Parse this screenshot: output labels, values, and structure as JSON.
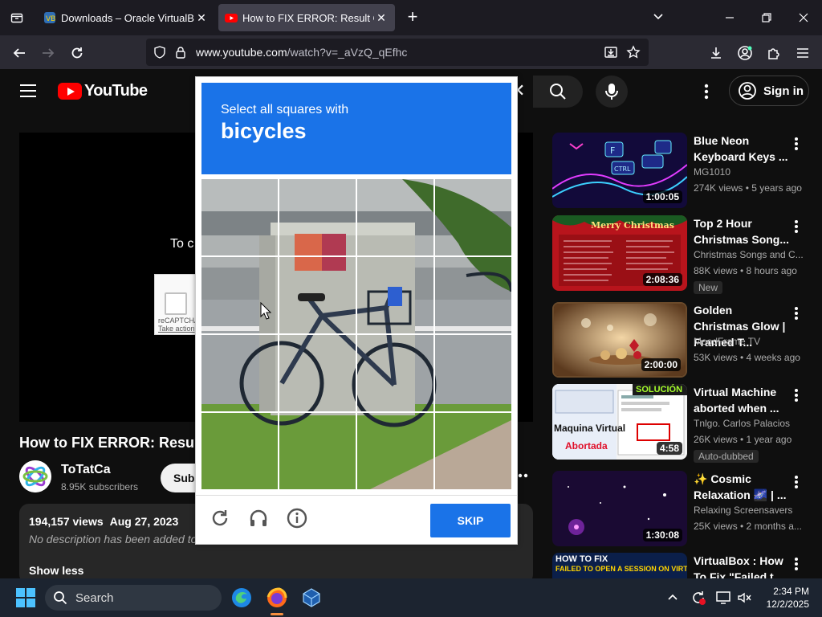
{
  "browser": {
    "tabs": [
      {
        "title": "Downloads – Oracle VirtualBox",
        "active": false
      },
      {
        "title": "How to FIX ERROR: Result Code",
        "active": true
      }
    ],
    "url_host": "www.youtube.com",
    "url_path": "/watch?v=_aVzQ_qEfhc"
  },
  "youtube": {
    "logo_text": "YouTube",
    "sign_in_label": "Sign in",
    "player_partial_text": "To c",
    "recaptcha_label": "reCAPTCHA",
    "recaptcha_action": "Take action",
    "video_title": "How to FIX ERROR: Resu",
    "channel_name": "ToTatCa",
    "channel_subs": "8.95K subscribers",
    "subscribe_label": "Subs",
    "views": "194,157 views",
    "date": "Aug 27, 2023",
    "description": "No description has been added to",
    "show_less": "Show less"
  },
  "recommendations": [
    {
      "title": "Blue Neon Keyboard Keys ...",
      "channel": "MG1010",
      "meta": "274K views • 5 years ago",
      "duration": "1:00:05",
      "badge": ""
    },
    {
      "title": "Top 2 Hour Christmas Song...",
      "channel": "Christmas Songs and C...",
      "meta": "88K views • 8 hours ago",
      "duration": "2:08:36",
      "badge": "New"
    },
    {
      "title": "Golden Christmas Glow | Framed T...",
      "channel": "MoodFrame TV",
      "meta": "53K views • 4 weeks ago",
      "duration": "2:00:00",
      "badge": ""
    },
    {
      "title": "Virtual Machine aborted when ...",
      "channel": "Tnlgo. Carlos Palacios",
      "meta": "26K views • 1 year ago",
      "duration": "4:58",
      "badge": "Auto-dubbed"
    },
    {
      "title": "✨ Cosmic Relaxation 🌌 | ...",
      "channel": "Relaxing Screensavers",
      "meta": "25K views • 2 months a...",
      "duration": "1:30:08",
      "badge": ""
    },
    {
      "title": "VirtualBox : How To Fix \"Failed t...",
      "channel": "",
      "meta": "",
      "duration": "",
      "badge": ""
    }
  ],
  "thumbnail_texts": {
    "christmas": "Merry Christmas",
    "vm_solucion": "SOLUCIÓN",
    "vm_maquina": "Maquina Virtual",
    "vm_abortada": "Abortada",
    "vbox_how": "HOW TO FIX",
    "vbox_fail": "FAILED TO OPEN A SESSION ON VIRTUALBOX"
  },
  "captcha": {
    "instruction": "Select all squares with",
    "target": "bicycles",
    "skip_label": "SKIP",
    "grid": "4x4"
  },
  "taskbar": {
    "search_label": "Search",
    "time": "2:34 PM",
    "date": "12/2/2025"
  },
  "colors": {
    "captcha_blue": "#1a73e8",
    "youtube_red": "#ff0000",
    "page_bg": "#0f0f0f",
    "browser_tabbar": "#1c1b22"
  }
}
